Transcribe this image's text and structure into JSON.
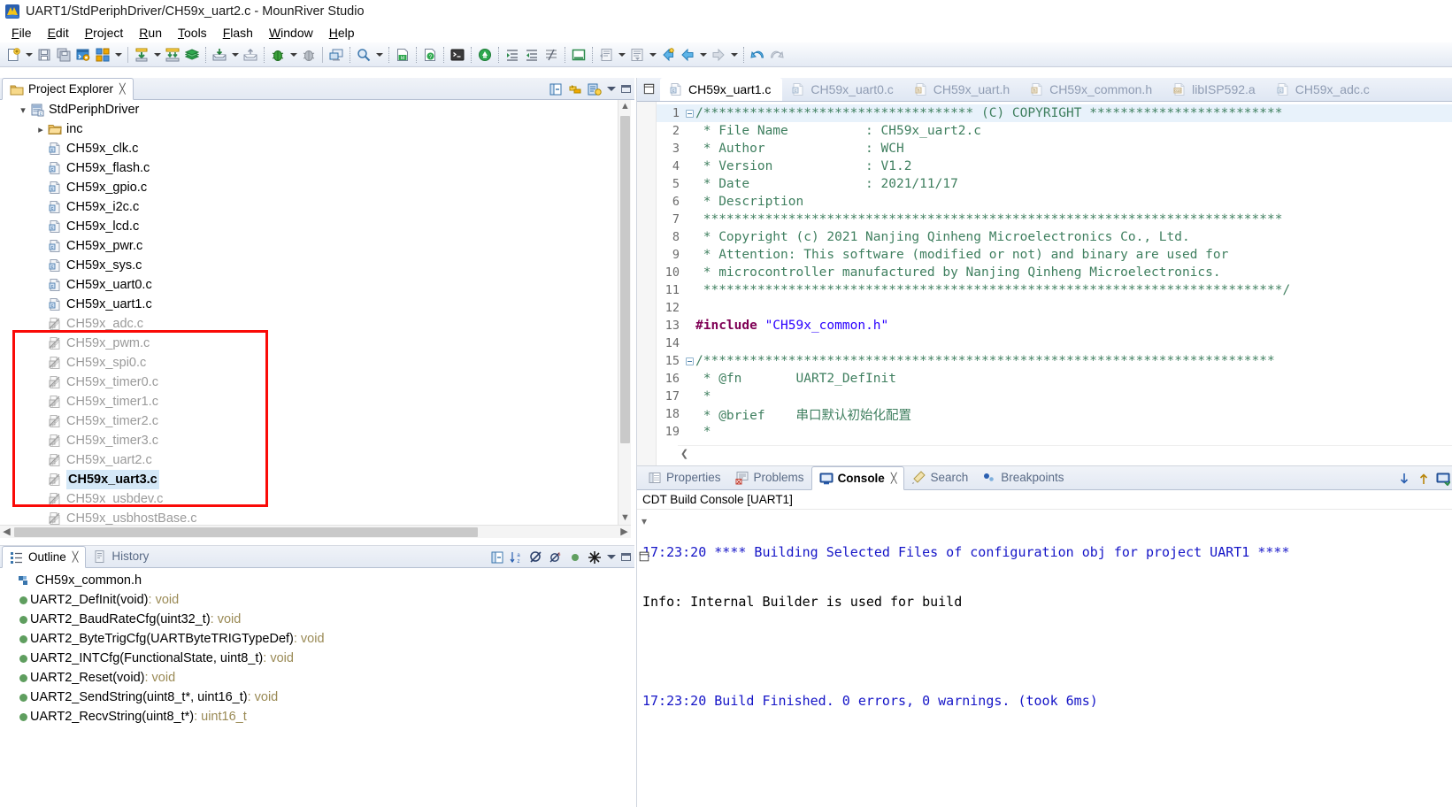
{
  "window": {
    "title": "UART1/StdPeriphDriver/CH59x_uart2.c - MounRiver Studio",
    "app_icon": "mounriver-logo-icon"
  },
  "menu": {
    "items": [
      {
        "label": "File",
        "mnemonic": "F"
      },
      {
        "label": "Edit",
        "mnemonic": "E"
      },
      {
        "label": "Project",
        "mnemonic": "P"
      },
      {
        "label": "Run",
        "mnemonic": "R"
      },
      {
        "label": "Tools",
        "mnemonic": "T"
      },
      {
        "label": "Flash",
        "mnemonic": "F"
      },
      {
        "label": "Window",
        "mnemonic": "W"
      },
      {
        "label": "Help",
        "mnemonic": "H"
      }
    ]
  },
  "toolbar": {
    "buttons": [
      "new-file-icon",
      "save-icon",
      "save-all-icon",
      "build-config-icon",
      "build-all-icon",
      "build-selected-icon",
      "build-project-icon",
      "clean-icon",
      "download-icon",
      "upload-icon",
      "debug-icon",
      "debug-attach-icon",
      "terminal-view-icon",
      "search-icon",
      "ld-file-icon",
      "help-doc-icon",
      "console-icon",
      "wch-link-icon",
      "indent-icon",
      "outdent-icon",
      "comment-icon",
      "toggle-view-icon",
      "last-edit-icon",
      "next-annotation-icon",
      "back-icon",
      "forward-icon",
      "undo-nav-icon"
    ]
  },
  "project_explorer": {
    "tab_label": "Project Explorer",
    "tab_icon": "project-explorer-icon",
    "toolbar_icons": [
      "collapse-all-icon",
      "link-with-editor-icon",
      "view-menu-icon",
      "minimize-icon",
      "maximize-icon"
    ],
    "tree": [
      {
        "label": "StdPeriphDriver",
        "icon": "project-icon",
        "depth": 0,
        "twist": "expanded",
        "state": "normal"
      },
      {
        "label": "inc",
        "icon": "folder-icon",
        "depth": 1,
        "twist": "collapsed",
        "state": "normal"
      },
      {
        "label": "CH59x_clk.c",
        "icon": "c-file-icon",
        "depth": 1,
        "twist": "none",
        "state": "normal"
      },
      {
        "label": "CH59x_flash.c",
        "icon": "c-file-icon",
        "depth": 1,
        "twist": "none",
        "state": "normal"
      },
      {
        "label": "CH59x_gpio.c",
        "icon": "c-file-icon",
        "depth": 1,
        "twist": "none",
        "state": "normal"
      },
      {
        "label": "CH59x_i2c.c",
        "icon": "c-file-icon",
        "depth": 1,
        "twist": "none",
        "state": "normal"
      },
      {
        "label": "CH59x_lcd.c",
        "icon": "c-file-icon",
        "depth": 1,
        "twist": "none",
        "state": "normal"
      },
      {
        "label": "CH59x_pwr.c",
        "icon": "c-file-icon",
        "depth": 1,
        "twist": "none",
        "state": "normal"
      },
      {
        "label": "CH59x_sys.c",
        "icon": "c-file-icon",
        "depth": 1,
        "twist": "none",
        "state": "normal"
      },
      {
        "label": "CH59x_uart0.c",
        "icon": "c-file-icon",
        "depth": 1,
        "twist": "none",
        "state": "normal"
      },
      {
        "label": "CH59x_uart1.c",
        "icon": "c-file-icon",
        "depth": 1,
        "twist": "none",
        "state": "normal"
      },
      {
        "label": "CH59x_adc.c",
        "icon": "c-file-excluded-icon",
        "depth": 1,
        "twist": "none",
        "state": "excluded"
      },
      {
        "label": "CH59x_pwm.c",
        "icon": "c-file-excluded-icon",
        "depth": 1,
        "twist": "none",
        "state": "excluded"
      },
      {
        "label": "CH59x_spi0.c",
        "icon": "c-file-excluded-icon",
        "depth": 1,
        "twist": "none",
        "state": "excluded"
      },
      {
        "label": "CH59x_timer0.c",
        "icon": "c-file-excluded-icon",
        "depth": 1,
        "twist": "none",
        "state": "excluded"
      },
      {
        "label": "CH59x_timer1.c",
        "icon": "c-file-excluded-icon",
        "depth": 1,
        "twist": "none",
        "state": "excluded"
      },
      {
        "label": "CH59x_timer2.c",
        "icon": "c-file-excluded-icon",
        "depth": 1,
        "twist": "none",
        "state": "excluded"
      },
      {
        "label": "CH59x_timer3.c",
        "icon": "c-file-excluded-icon",
        "depth": 1,
        "twist": "none",
        "state": "excluded"
      },
      {
        "label": "CH59x_uart2.c",
        "icon": "c-file-excluded-icon",
        "depth": 1,
        "twist": "none",
        "state": "excluded"
      },
      {
        "label": "CH59x_uart3.c",
        "icon": "c-file-excluded-icon",
        "depth": 1,
        "twist": "none",
        "state": "excluded-selected"
      },
      {
        "label": "CH59x_usbdev.c",
        "icon": "c-file-excluded-icon",
        "depth": 1,
        "twist": "none",
        "state": "excluded"
      },
      {
        "label": "CH59x_usbhostBase.c",
        "icon": "c-file-excluded-icon",
        "depth": 1,
        "twist": "none",
        "state": "excluded"
      }
    ],
    "annotation": {
      "color": "#fa0a07",
      "shape": "rectangle"
    }
  },
  "editor": {
    "tabs": [
      {
        "label": "CH59x_uart1.c",
        "icon": "c-file-icon",
        "active": false
      },
      {
        "label": "CH59x_uart0.c",
        "icon": "c-file-icon",
        "active": false
      },
      {
        "label": "CH59x_uart.h",
        "icon": "h-file-icon",
        "active": false
      },
      {
        "label": "CH59x_common.h",
        "icon": "h-file-icon",
        "active": false
      },
      {
        "label": "libISP592.a",
        "icon": "archive-file-icon",
        "active": false
      },
      {
        "label": "CH59x_adc.c",
        "icon": "c-file-icon",
        "active": false
      }
    ],
    "lines": [
      {
        "n": 1,
        "fold": true,
        "highlight": true,
        "text": "/*********************************** (C) COPYRIGHT *************************",
        "cls": "c-comment"
      },
      {
        "n": 2,
        "fold": false,
        "highlight": false,
        "text": " * File Name          : CH59x_uart2.c",
        "cls": "c-comment"
      },
      {
        "n": 3,
        "fold": false,
        "highlight": false,
        "text": " * Author             : WCH",
        "cls": "c-comment"
      },
      {
        "n": 4,
        "fold": false,
        "highlight": false,
        "text": " * Version            : V1.2",
        "cls": "c-comment"
      },
      {
        "n": 5,
        "fold": false,
        "highlight": false,
        "text": " * Date               : 2021/11/17",
        "cls": "c-comment"
      },
      {
        "n": 6,
        "fold": false,
        "highlight": false,
        "text": " * Description",
        "cls": "c-comment"
      },
      {
        "n": 7,
        "fold": false,
        "highlight": false,
        "text": " ***************************************************************************",
        "cls": "c-comment"
      },
      {
        "n": 8,
        "fold": false,
        "highlight": false,
        "text": " * Copyright (c) 2021 Nanjing Qinheng Microelectronics Co., Ltd.",
        "cls": "c-comment"
      },
      {
        "n": 9,
        "fold": false,
        "highlight": false,
        "text": " * Attention: This software (modified or not) and binary are used for",
        "cls": "c-comment"
      },
      {
        "n": 10,
        "fold": false,
        "highlight": false,
        "text": " * microcontroller manufactured by Nanjing Qinheng Microelectronics.",
        "cls": "c-comment"
      },
      {
        "n": 11,
        "fold": false,
        "highlight": false,
        "text": " ***************************************************************************/",
        "cls": "c-comment"
      },
      {
        "n": 12,
        "fold": false,
        "highlight": false,
        "text": "",
        "cls": ""
      },
      {
        "n": 13,
        "fold": false,
        "highlight": false,
        "text": "#include \"CH59x_common.h\"",
        "cls": "include"
      },
      {
        "n": 14,
        "fold": false,
        "highlight": false,
        "text": "",
        "cls": ""
      },
      {
        "n": 15,
        "fold": true,
        "highlight": false,
        "text": "/**************************************************************************",
        "cls": "c-comment"
      },
      {
        "n": 16,
        "fold": false,
        "highlight": false,
        "text": " * @fn       UART2_DefInit",
        "cls": "c-comment"
      },
      {
        "n": 17,
        "fold": false,
        "highlight": false,
        "text": " *",
        "cls": "c-comment"
      },
      {
        "n": 18,
        "fold": false,
        "highlight": false,
        "text": " * @brief    串口默认初始化配置",
        "cls": "c-comment"
      },
      {
        "n": 19,
        "fold": false,
        "highlight": false,
        "text": " *",
        "cls": "c-comment"
      }
    ],
    "include_directive": "#include",
    "include_target": "\"CH59x_common.h\""
  },
  "bottom_panel": {
    "tabs": [
      {
        "label": "Properties",
        "icon": "properties-icon",
        "active": false
      },
      {
        "label": "Problems",
        "icon": "problems-icon",
        "active": false
      },
      {
        "label": "Console",
        "icon": "console-icon",
        "active": true
      },
      {
        "label": "Search",
        "icon": "search-icon",
        "active": false
      },
      {
        "label": "Breakpoints",
        "icon": "breakpoints-icon",
        "active": false
      }
    ],
    "console_title": "CDT Build Console [UART1]",
    "toolbar_icons": [
      "scroll-lock-icon",
      "pin-console-icon",
      "display-selected-console-icon"
    ],
    "lines": [
      {
        "text": "17:23:20 **** Building Selected Files of configuration obj for project UART1 ****",
        "color": "blue"
      },
      {
        "text": "Info: Internal Builder is used for build",
        "color": "black"
      },
      {
        "text": "",
        "color": "black"
      },
      {
        "text": "17:23:20 Build Finished. 0 errors, 0 warnings. (took 6ms)",
        "color": "blue"
      }
    ]
  },
  "outline": {
    "tabs": [
      {
        "label": "Outline",
        "icon": "outline-icon",
        "active": true
      },
      {
        "label": "History",
        "icon": "history-icon",
        "active": false
      }
    ],
    "toolbar_icons": [
      "collapse-all-icon",
      "sort-icon",
      "hide-fields-icon",
      "hide-static-icon",
      "hide-nonpublic-icon",
      "filters-icon",
      "view-menu-icon",
      "minimize-icon"
    ],
    "items": [
      {
        "label": "CH59x_common.h",
        "type": "",
        "icon": "include-icon"
      },
      {
        "label": "UART2_DefInit(void)",
        "type": " : void",
        "icon": "function-icon"
      },
      {
        "label": "UART2_BaudRateCfg(uint32_t)",
        "type": " : void",
        "icon": "function-icon"
      },
      {
        "label": "UART2_ByteTrigCfg(UARTByteTRIGTypeDef)",
        "type": " : void",
        "icon": "function-icon"
      },
      {
        "label": "UART2_INTCfg(FunctionalState, uint8_t)",
        "type": " : void",
        "icon": "function-icon"
      },
      {
        "label": "UART2_Reset(void)",
        "type": " : void",
        "icon": "function-icon"
      },
      {
        "label": "UART2_SendString(uint8_t*, uint16_t)",
        "type": " : void",
        "icon": "function-icon"
      },
      {
        "label": "UART2_RecvString(uint8_t*)",
        "type": " : uint16_t",
        "icon": "function-icon"
      }
    ]
  },
  "colors": {
    "annotation_red": "#fa0a07",
    "comment_green": "#3f7f5f",
    "keyword_purple": "#7f0055",
    "string_blue": "#2a00ff",
    "console_blue": "#1515c7",
    "selection_blue": "#d4e8f7"
  }
}
